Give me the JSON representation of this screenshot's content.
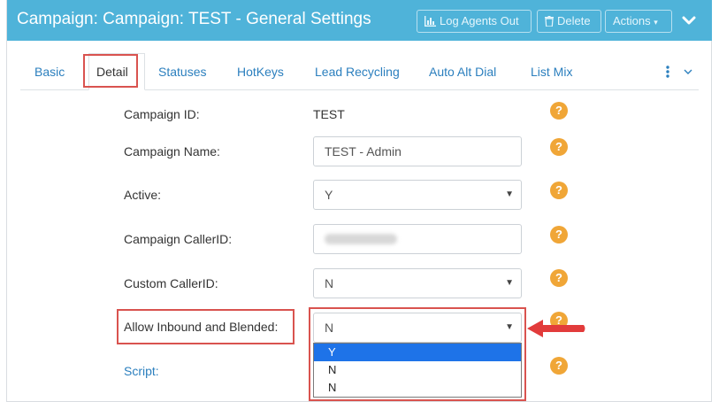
{
  "header": {
    "title": "Campaign: Campaign: TEST - General Settings",
    "log_agents_out_label": "Log Agents Out",
    "delete_label": "Delete",
    "actions_label": "Actions"
  },
  "tabs": [
    {
      "label": "Basic"
    },
    {
      "label": "Detail"
    },
    {
      "label": "Statuses"
    },
    {
      "label": "HotKeys"
    },
    {
      "label": "Lead Recycling"
    },
    {
      "label": "Auto Alt Dial"
    },
    {
      "label": "List Mix"
    }
  ],
  "form": {
    "campaign_id": {
      "label": "Campaign ID:",
      "value": "TEST"
    },
    "campaign_name": {
      "label": "Campaign Name:",
      "value": "TEST - Admin"
    },
    "active": {
      "label": "Active:",
      "value": "Y"
    },
    "campaign_callerid": {
      "label": "Campaign CallerID:",
      "value": "(blurred)"
    },
    "custom_callerid": {
      "label": "Custom CallerID:",
      "value": "N"
    },
    "allow_inbound_blended": {
      "label": "Allow Inbound and Blended:",
      "value": "N",
      "options": [
        "Y",
        "N",
        "N"
      ],
      "highlighted_option": "Y"
    },
    "script": {
      "label": "Script:"
    }
  },
  "help_icon_text": "?",
  "colors": {
    "header_bg": "#4fb3d9",
    "link": "#2b7fbe",
    "help_badge": "#f0a637",
    "highlight_box": "#d9534f",
    "annotation_arrow": "#e23b3b",
    "dropdown_selected": "#1e73e8"
  }
}
